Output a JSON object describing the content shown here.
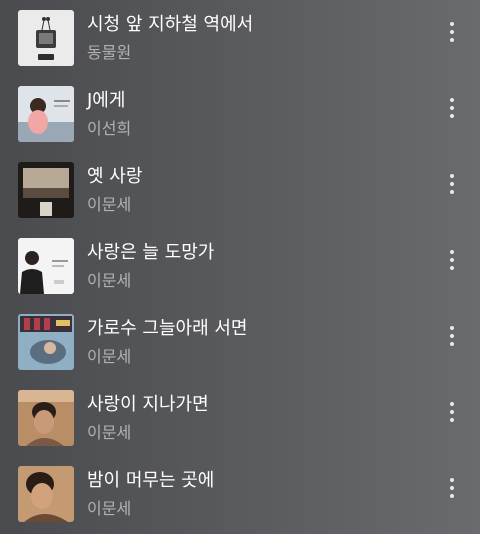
{
  "songs": [
    {
      "title": "시청 앞 지하철 역에서",
      "artist": "동물원"
    },
    {
      "title": "J에게",
      "artist": "이선희"
    },
    {
      "title": "옛 사랑",
      "artist": "이문세"
    },
    {
      "title": "사랑은 늘 도망가",
      "artist": "이문세"
    },
    {
      "title": "가로수 그늘아래 서면",
      "artist": "이문세"
    },
    {
      "title": "사랑이 지나가면",
      "artist": "이문세"
    },
    {
      "title": "밤이 머무는 곳에",
      "artist": "이문세"
    }
  ],
  "icons": {
    "more": "more-vertical-icon"
  }
}
